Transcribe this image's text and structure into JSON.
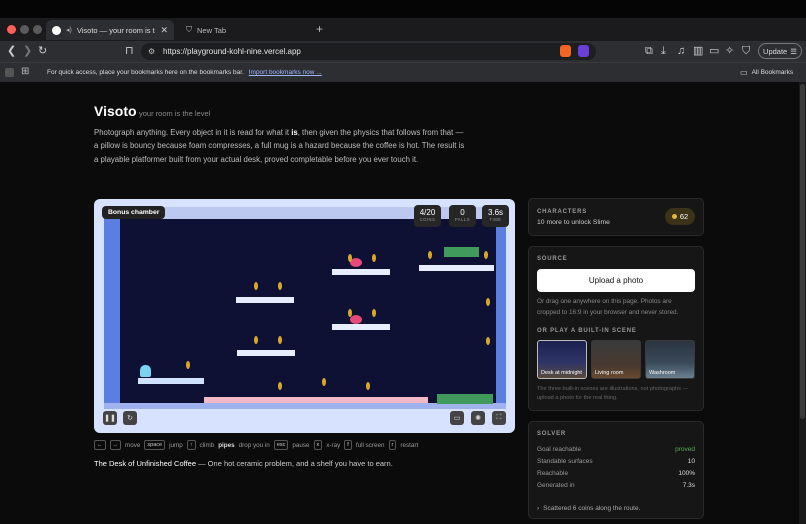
{
  "browser": {
    "active_tab_title": "Visoto — your room is the le",
    "inactive_tab_title": "New Tab",
    "url": "https://playground-kohl-nine.vercel.app",
    "update_label": "Update",
    "bookmarks_message": "For quick access, place your bookmarks here on the bookmarks bar.",
    "import_bookmarks_link": "Import bookmarks now ...",
    "all_bookmarks_label": "All Bookmarks"
  },
  "header": {
    "title": "Visoto",
    "subtitle": "your room is the level"
  },
  "intro": {
    "part1": "Photograph anything. Every object in it is read for what it ",
    "emphasis": "is",
    "part2": ", then given the physics that follows from that — a pillow is bouncy because foam compresses, a full mug is a hazard because the coffee is hot. The result is a playable platformer built from your actual desk, proved completable before you ever touch it."
  },
  "game": {
    "badge": "Bonus chamber",
    "stats": [
      {
        "value": "4/20",
        "label": "COINS"
      },
      {
        "value": "0",
        "label": "FALLS"
      },
      {
        "value": "3.6s",
        "label": "TIME"
      }
    ],
    "controls": [
      {
        "keys": [
          "←",
          "→"
        ],
        "action": "move"
      },
      {
        "keys": [
          "space"
        ],
        "action": "jump"
      },
      {
        "keys": [
          "↑"
        ],
        "action": "climb"
      },
      {
        "keys": [],
        "bold": "pipes",
        "action": "drop you in"
      },
      {
        "keys": [
          "esc"
        ],
        "action": "pause"
      },
      {
        "keys": [
          "x"
        ],
        "action": "x-ray"
      },
      {
        "keys": [
          "f"
        ],
        "action": "full screen"
      },
      {
        "keys": [
          "r"
        ],
        "action": "restart"
      }
    ],
    "level_name": "The Desk of Unfinished Coffee",
    "level_desc": " — One hot ceramic problem, and a shelf you have to earn."
  },
  "characters": {
    "title": "CHARACTERS",
    "text": "10 more to unlock Slime",
    "coins": "62"
  },
  "source": {
    "title": "SOURCE",
    "upload_label": "Upload a photo",
    "hint": "Or drag one anywhere on this page. Photos are cropped to 16:9 in your browser and never stored.",
    "builtin_title": "OR PLAY A BUILT-IN SCENE",
    "scenes": [
      "Desk at midnight",
      "Living room",
      "Washroom"
    ],
    "note": "The three built-in scenes are illustrations, not photographs — upload a photo for the real thing."
  },
  "solver": {
    "title": "SOLVER",
    "rows": [
      {
        "label": "Goal reachable",
        "value": "proved"
      },
      {
        "label": "Standable surfaces",
        "value": "10"
      },
      {
        "label": "Reachable",
        "value": "100%"
      },
      {
        "label": "Generated in",
        "value": "7.3s"
      }
    ],
    "expand_label": "Scattered 6 coins along the route."
  },
  "colors": {
    "accent_green": "#4caf50",
    "coin": "#e8b637",
    "game_bg": "#0e1133"
  }
}
